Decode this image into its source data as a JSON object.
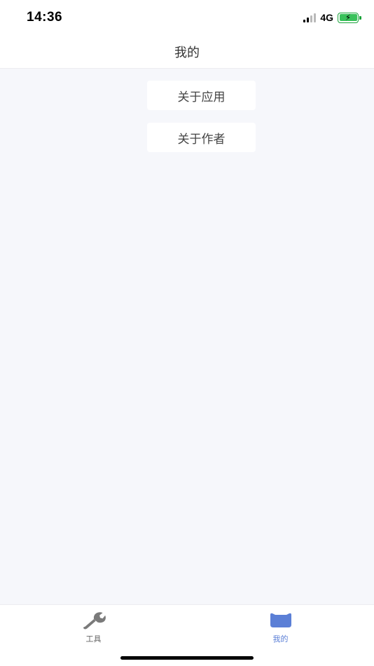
{
  "status_bar": {
    "time": "14:36",
    "network": "4G",
    "battery_charging": true,
    "signal_bars_active": 2,
    "signal_bars_total": 4
  },
  "nav": {
    "title": "我的"
  },
  "menu": {
    "items": [
      {
        "label": "关于应用"
      },
      {
        "label": "关于作者"
      }
    ]
  },
  "tabs": [
    {
      "label": "工具",
      "icon": "wrench-icon",
      "active": false
    },
    {
      "label": "我的",
      "icon": "profile-icon",
      "active": true
    }
  ],
  "colors": {
    "active_tab": "#5b7fd6",
    "inactive_tab": "#777777",
    "background": "#f6f7fb",
    "battery": "#39c15a"
  }
}
